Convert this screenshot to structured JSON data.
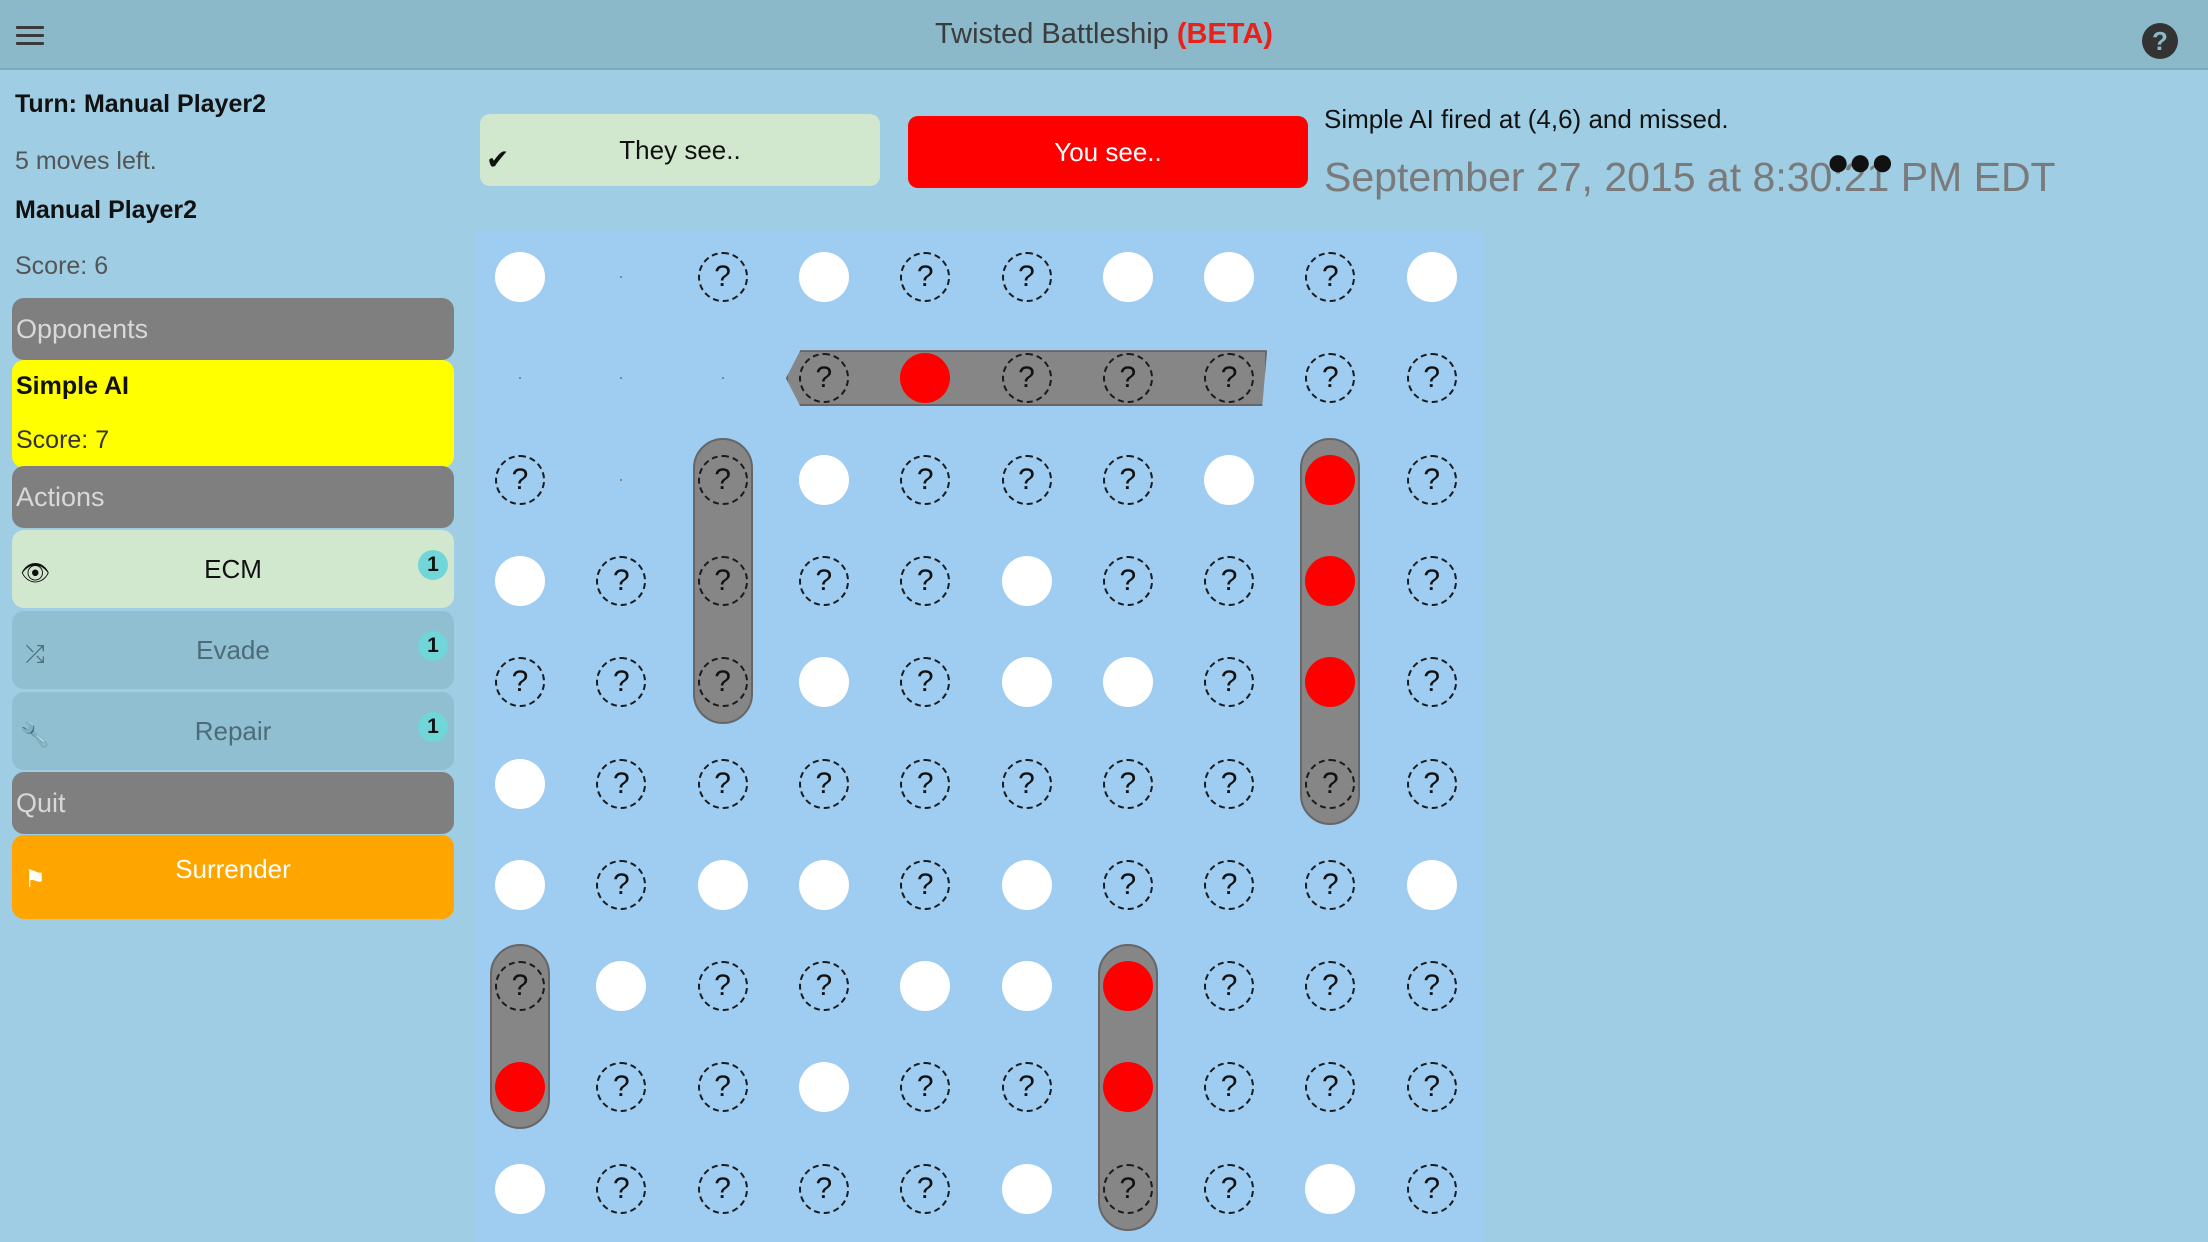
{
  "header": {
    "title": "Twisted Battleship",
    "beta": "(BETA)",
    "menu_icon": "hamburger-menu-icon",
    "help_icon": "question-icon",
    "help_glyph": "?"
  },
  "sidebar": {
    "turn": "Turn: Manual Player2",
    "moves_left": "5 moves left.",
    "player_name": "Manual Player2",
    "player_score": "Score: 6",
    "opponents_header": "Opponents",
    "opponent": {
      "name": "Simple AI",
      "score": "Score: 7",
      "highlight": "#ffff00"
    },
    "actions_header": "Actions",
    "actions": [
      {
        "label": "ECM",
        "count": "1",
        "icon": "eye-slash-icon",
        "glyph": "👁"
      },
      {
        "label": "Evade",
        "count": "1",
        "icon": "shuffle-icon",
        "glyph": "⤮"
      },
      {
        "label": "Repair",
        "count": "1",
        "icon": "wrench-icon",
        "glyph": "🔧"
      }
    ],
    "quit_header": "Quit",
    "surrender": {
      "label": "Surrender",
      "icon": "flag-icon",
      "glyph": "⚑"
    }
  },
  "views": {
    "they_see": "They see..",
    "they_see_check": "✔",
    "you_see": "You see..",
    "you_see_color": "#ff0000"
  },
  "status": {
    "message": "Simple AI fired at (4,6) and missed.",
    "date": "September 27, 2015 at 8:30:21 PM EDT",
    "more": "●●●"
  },
  "board": {
    "size": 10,
    "legend": {
      "W": "miss",
      "Q": "unknown",
      "R": "hit",
      ".": "empty"
    },
    "unknown_glyph": "?",
    "rows": [
      "W.QWQQWWQW",
      "...QRQQQQQ",
      "Q.QWQQQWRQ",
      "WQQQQWQQRQ",
      "QQQWQWWQRQ",
      "WQQQQQQQQQ",
      "WQWWQWQQQW",
      "QWQQWWRQQQ",
      "RQQWQQRQQQ",
      "WQQQQWQQWQ"
    ],
    "ships": [
      {
        "orientation": "horizontal",
        "row": 1,
        "col": 3,
        "length": 5
      },
      {
        "orientation": "vertical",
        "row": 2,
        "col": 2,
        "length": 3
      },
      {
        "orientation": "vertical",
        "row": 2,
        "col": 8,
        "length": 4
      },
      {
        "orientation": "vertical",
        "row": 7,
        "col": 0,
        "length": 2
      },
      {
        "orientation": "vertical",
        "row": 7,
        "col": 6,
        "length": 3
      }
    ]
  }
}
